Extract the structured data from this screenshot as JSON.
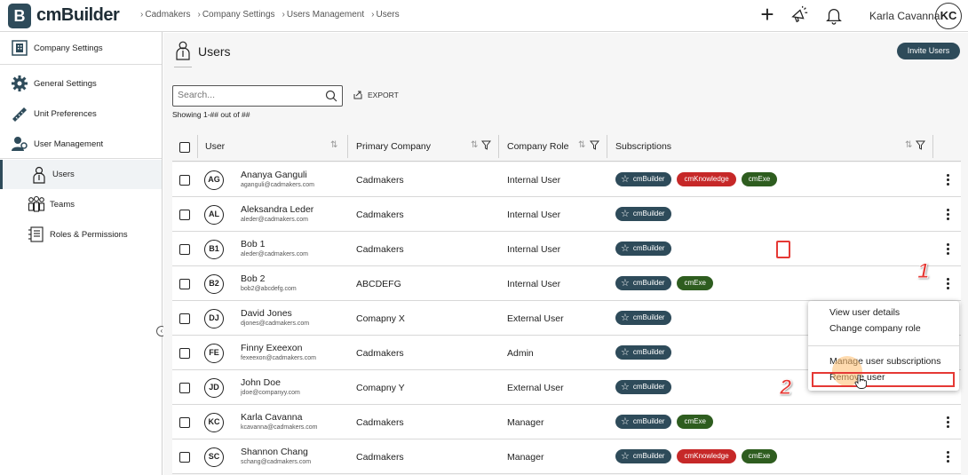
{
  "app": {
    "logo_letter": "B",
    "logo_text": "cmBuilder"
  },
  "breadcrumb": [
    "Cadmakers",
    "Company Settings",
    "Users Management",
    "Users"
  ],
  "header": {
    "user_name": "Karla Cavanna",
    "user_initials": "KC"
  },
  "sidebar": {
    "items": [
      {
        "label": "Company Settings",
        "icon": "building-icon"
      },
      {
        "label": "General Settings",
        "icon": "gear-icon"
      },
      {
        "label": "Unit Preferences",
        "icon": "ruler-icon"
      },
      {
        "label": "User Management",
        "icon": "user-management-icon"
      },
      {
        "label": "Users",
        "icon": "user-icon"
      },
      {
        "label": "Teams",
        "icon": "team-icon"
      },
      {
        "label": "Roles & Permissions",
        "icon": "roles-icon"
      }
    ]
  },
  "page": {
    "title": "Users",
    "invite_label": "Invite Users",
    "search_placeholder": "Search...",
    "export_label": "EXPORT",
    "showing": "Showing 1-## out of ##"
  },
  "table": {
    "headers": {
      "user": "User",
      "company": "Primary Company",
      "role": "Company Role",
      "subscriptions": "Subscriptions"
    },
    "rows": [
      {
        "initials": "AG",
        "name": "Ananya Ganguli",
        "email": "aganguli@cadmakers.com",
        "company": "Cadmakers",
        "role": "Internal User",
        "subs": [
          "cmBuilder",
          "cmKnowledge",
          "cmExe"
        ]
      },
      {
        "initials": "AL",
        "name": "Aleksandra Leder",
        "email": "aleder@cadmakers.com",
        "company": "Cadmakers",
        "role": "Internal User",
        "subs": [
          "cmBuilder"
        ]
      },
      {
        "initials": "B1",
        "name": "Bob 1",
        "email": "aleder@cadmakers.com",
        "company": "Cadmakers",
        "role": "Internal User",
        "subs": [
          "cmBuilder"
        ]
      },
      {
        "initials": "B2",
        "name": "Bob 2",
        "email": "bob2@abcdefg.com",
        "company": "ABCDEFG",
        "role": "Internal User",
        "subs": [
          "cmBuilder",
          "cmExe"
        ]
      },
      {
        "initials": "DJ",
        "name": "David Jones",
        "email": "djones@cadmakers.com",
        "company": "Comapny X",
        "role": "External User",
        "subs": [
          "cmBuilder"
        ]
      },
      {
        "initials": "FE",
        "name": "Finny Exeexon",
        "email": "fexeexon@cadmakers.com",
        "company": "Cadmakers",
        "role": "Admin",
        "subs": [
          "cmBuilder"
        ]
      },
      {
        "initials": "JD",
        "name": "John Doe",
        "email": "jdoe@companyy.com",
        "company": "Comapny Y",
        "role": "External User",
        "subs": [
          "cmBuilder"
        ]
      },
      {
        "initials": "KC",
        "name": "Karla Cavanna",
        "email": "kcavanna@cadmakers.com",
        "company": "Cadmakers",
        "role": "Manager",
        "subs": [
          "cmBuilder",
          "cmExe"
        ]
      },
      {
        "initials": "SC",
        "name": "Shannon Chang",
        "email": "schang@cadmakers.com",
        "company": "Cadmakers",
        "role": "Manager",
        "subs": [
          "cmBuilder",
          "cmKnowledge",
          "cmExe"
        ]
      }
    ]
  },
  "context_menu": {
    "items": [
      "View user details",
      "Change company role",
      "Manage user subscriptions",
      "Remove user"
    ]
  },
  "annotations": {
    "step1": "1",
    "step2": "2"
  },
  "colors": {
    "brand": "#2e4b5a",
    "knowledge": "#c62828",
    "exe": "#2e5d1f",
    "highlight": "#e53935"
  }
}
